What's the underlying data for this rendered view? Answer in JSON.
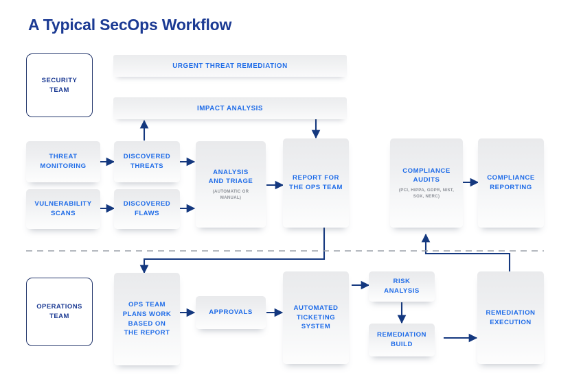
{
  "page": {
    "title": "A Typical SecOps Workflow",
    "background": "#ffffff",
    "title_color": "#1b3a93",
    "node_label_color": "#1f6ce8",
    "node_sub_color": "#8b8f96",
    "connector_color": "#14387f",
    "divider_color": "#9aa0a8"
  },
  "swimlanes": [
    {
      "name": "security",
      "label": "SECURITY\nTEAM",
      "label_line1": "SECURITY",
      "label_line2": "TEAM"
    },
    {
      "name": "operations",
      "label": "OPERATIONS\nTEAM",
      "label_line1": "OPERATIONS",
      "label_line2": "TEAM"
    }
  ],
  "banners": [
    {
      "id": "urgent-threat-remediation",
      "label": "URGENT THREAT REMEDIATION"
    },
    {
      "id": "impact-analysis",
      "label": "IMPACT ANALYSIS"
    }
  ],
  "nodes": [
    {
      "id": "threat-monitoring",
      "line1": "THREAT",
      "line2": "MONITORING",
      "line3": "",
      "line4": "",
      "sub": ""
    },
    {
      "id": "discovered-threats",
      "line1": "DISCOVERED",
      "line2": "THREATS",
      "line3": "",
      "line4": "",
      "sub": ""
    },
    {
      "id": "vulnerability-scans",
      "line1": "VULNERABILITY",
      "line2": "SCANS",
      "line3": "",
      "line4": "",
      "sub": ""
    },
    {
      "id": "discovered-flaws",
      "line1": "DISCOVERED",
      "line2": "FLAWS",
      "line3": "",
      "line4": "",
      "sub": ""
    },
    {
      "id": "analysis-and-triage",
      "line1": "ANALYSIS",
      "line2": "AND TRIAGE",
      "line3": "",
      "line4": "",
      "sub": "(AUTOMATIC OR MANUAL)"
    },
    {
      "id": "report-for-ops-team",
      "line1": "REPORT FOR",
      "line2": "THE  OPS TEAM",
      "line3": "",
      "line4": "",
      "sub": ""
    },
    {
      "id": "compliance-audits",
      "line1": "COMPLIANCE",
      "line2": "AUDITS",
      "line3": "",
      "line4": "",
      "sub": "(PCI, HIPPA, GDPR, NIST, SOX, NERC)"
    },
    {
      "id": "compliance-reporting",
      "line1": "COMPLIANCE",
      "line2": "REPORTING",
      "line3": "",
      "line4": "",
      "sub": ""
    },
    {
      "id": "ops-team-plans-work",
      "line1": "OPS TEAM",
      "line2": "PLANS WORK",
      "line3": "BASED ON",
      "line4": "THE REPORT",
      "sub": ""
    },
    {
      "id": "approvals",
      "line1": "APPROVALS",
      "line2": "",
      "line3": "",
      "line4": "",
      "sub": ""
    },
    {
      "id": "automated-ticketing",
      "line1": "AUTOMATED",
      "line2": "TICKETING",
      "line3": "SYSTEM",
      "line4": "",
      "sub": ""
    },
    {
      "id": "risk-analysis",
      "line1": "RISK",
      "line2": "ANALYSIS",
      "line3": "",
      "line4": "",
      "sub": ""
    },
    {
      "id": "remediation-build",
      "line1": "REMEDIATION",
      "line2": "BUILD",
      "line3": "",
      "line4": "",
      "sub": ""
    },
    {
      "id": "remediation-execution",
      "line1": "REMEDIATION",
      "line2": "EXECUTION",
      "line3": "",
      "line4": "",
      "sub": ""
    }
  ]
}
